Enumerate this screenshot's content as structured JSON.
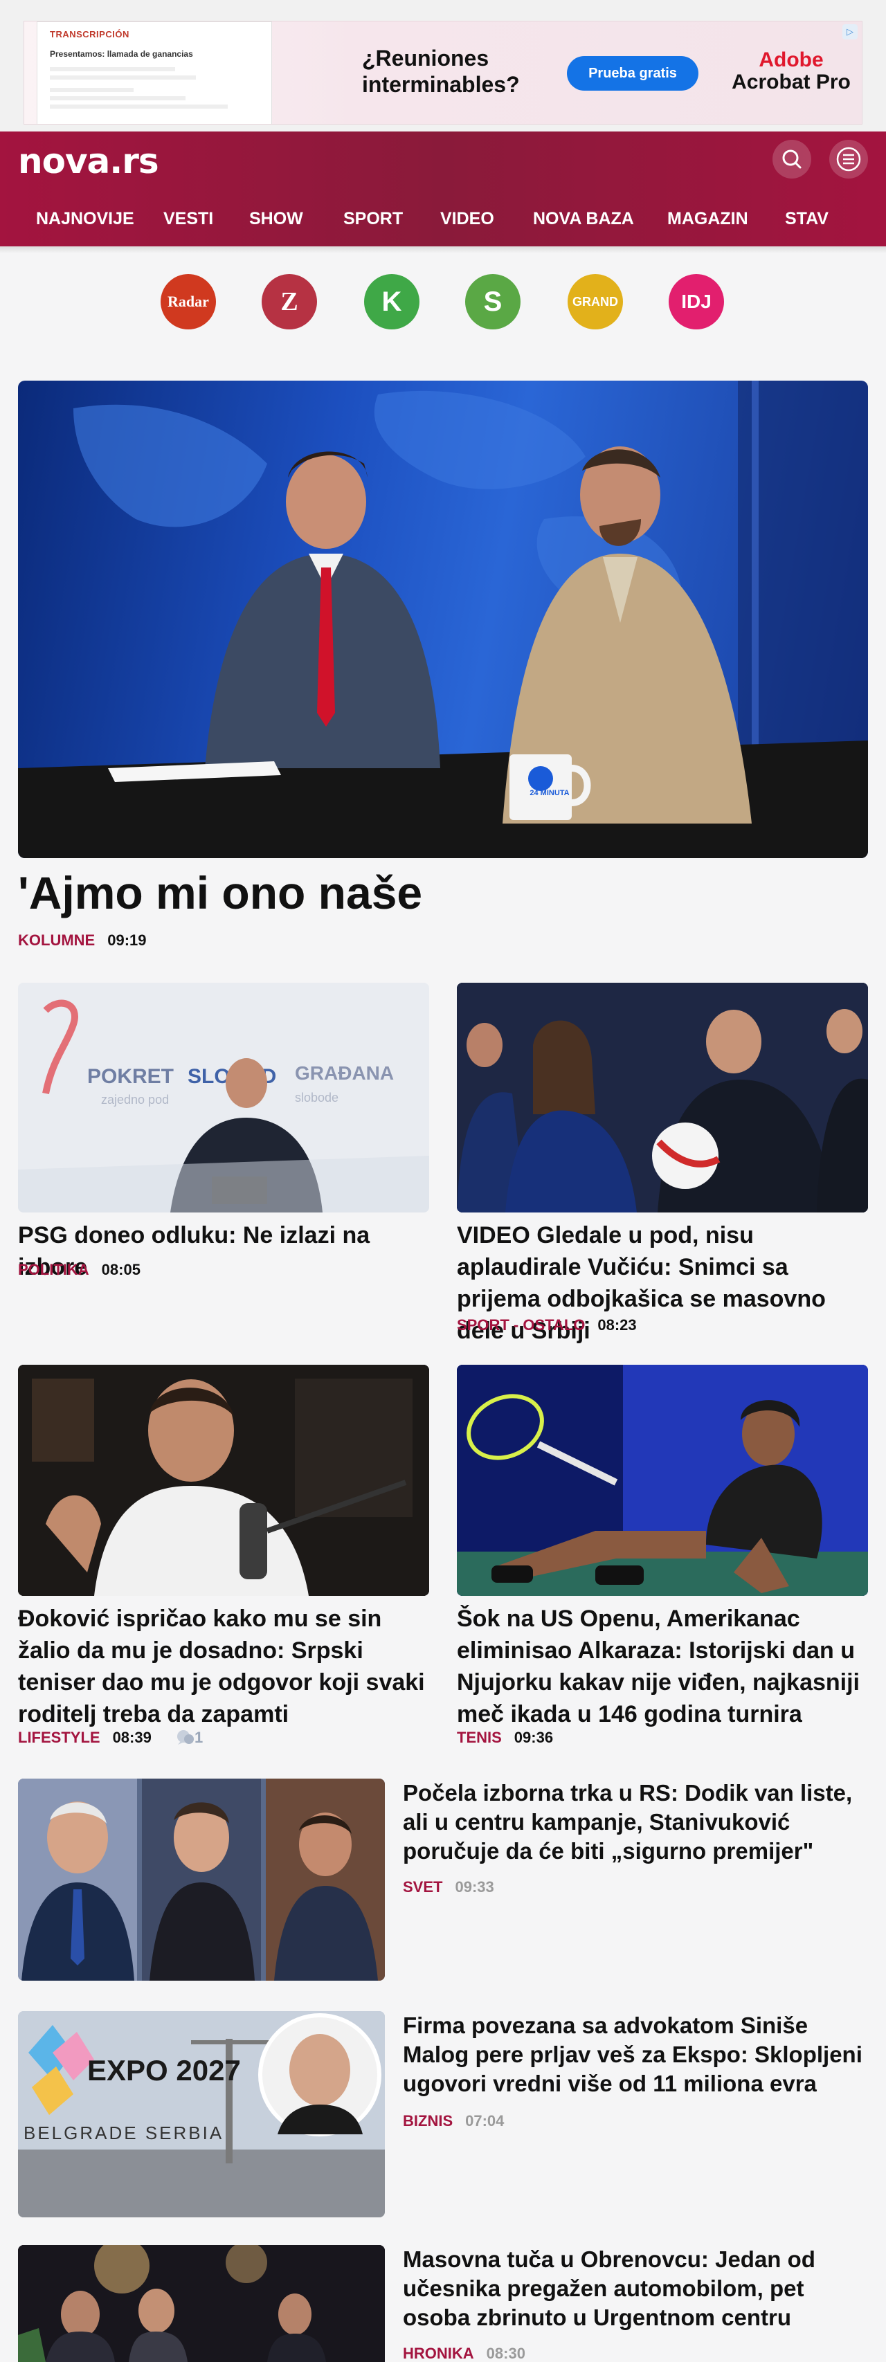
{
  "ad": {
    "doc_tag": "TRANSCRIPCIÓN",
    "doc_heading": "Presentamos: llamada de ganancias",
    "headline": "¿Reuniones interminables?",
    "cta": "Prueba gratis",
    "brand_top": "Adobe",
    "brand_bottom": "Acrobat Pro",
    "info_icon": "info-triangle-icon"
  },
  "header": {
    "logo": "nova.rs",
    "accent": "#a3143f",
    "search_icon": "search-icon",
    "menu_icon": "hamburger-menu-icon",
    "nav": [
      "NAJNOVIJE",
      "VESTI",
      "SHOW",
      "SPORT",
      "VIDEO",
      "NOVA BAZA",
      "MAGAZIN",
      "STAV"
    ]
  },
  "brands": [
    {
      "label": "Radar",
      "color": "#d0391f"
    },
    {
      "label": "Z",
      "color": "#b63243"
    },
    {
      "label": "K",
      "color": "#3fa847"
    },
    {
      "label": "S",
      "color": "#5aa845"
    },
    {
      "label": "GRAND",
      "color": "#e2b11b"
    },
    {
      "label": "IDJ",
      "color": "#e21f6e"
    }
  ],
  "hero": {
    "title": "'Ajmo mi ono naše",
    "category": "KOLUMNE",
    "time": "09:19",
    "mug_text": "24 MINUTA"
  },
  "grid": [
    {
      "title": "PSG doneo odluku: Ne izlazi na izbore",
      "category": "POLITIKA",
      "time": "08:05",
      "image_text": "POKRET SLOBODNIH GRAĐANA"
    },
    {
      "title": "VIDEO Gledale u pod, nisu aplaudirale Vučiću: Snimci sa prijema odbojkašica se masovno dele u Srbiji",
      "category": "SPORT - OSTALO",
      "time": "08:23"
    },
    {
      "title": "Đoković ispričao kako mu se sin žalio da mu je dosadno: Srpski teniser dao mu je odgovor koji svaki roditelj treba da zapamti",
      "category": "LIFESTYLE",
      "time": "08:39",
      "comments": "1"
    },
    {
      "title": "Šok na US Openu, Amerikanac eliminisao Alkaraza: Istorijski dan u Njujorku kakav nije viđen, najkasniji meč ikada u 146 godina turnira",
      "category": "TENIS",
      "time": "09:36"
    }
  ],
  "list": [
    {
      "title": "Počela izborna trka u RS: Dodik van liste, ali u centru kampanje, Stanivuković poručuje da će biti „sigurno premijer\"",
      "category": "SVET",
      "time": "09:33"
    },
    {
      "title": "Firma povezana sa advokatom Siniše Malog pere prljav veš za Ekspo: Sklopljeni ugovori vredni više od 11 miliona evra",
      "category": "BIZNIS",
      "time": "07:04",
      "image_text": "EXPO 2027",
      "image_sub": "BELGRADE SERBIA"
    },
    {
      "title": "Masovna tuča u Obrenovcu: Jedan od učesnika pregažen automobilom, pet osoba zbrinuto u Urgentnom centru",
      "category": "HRONIKA",
      "time": "08:30"
    }
  ]
}
